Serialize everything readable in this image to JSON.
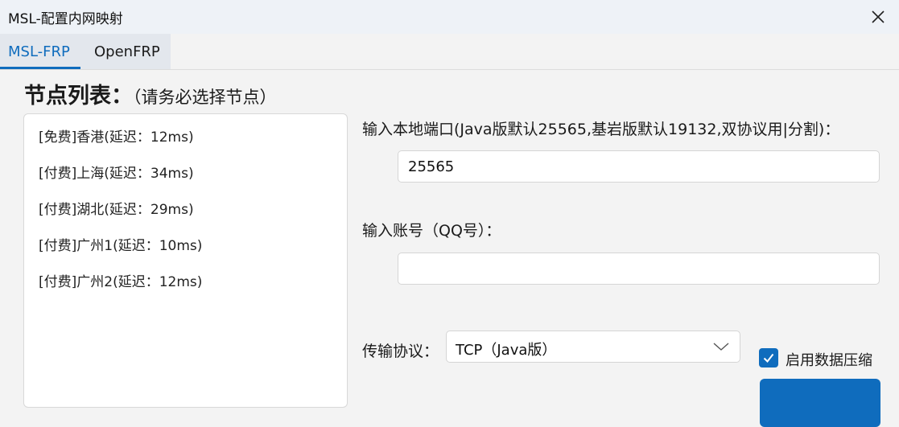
{
  "window": {
    "title": "MSL-配置内网映射"
  },
  "tabs": [
    {
      "label": "MSL-FRP",
      "active": true
    },
    {
      "label": "OpenFRP",
      "active": false
    }
  ],
  "node_section": {
    "title": "节点列表：",
    "hint": "（请务必选择节点）",
    "nodes": [
      "[免费]香港(延迟：12ms)",
      "[付费]上海(延迟：34ms)",
      "[付费]湖北(延迟：29ms)",
      "[付费]广州1(延迟：10ms)",
      "[付费]广州2(延迟：12ms)"
    ]
  },
  "port_field": {
    "label": "输入本地端口(Java版默认25565,基岩版默认19132,双协议用|分割)：",
    "value": "25565"
  },
  "account_field": {
    "label": "输入账号（QQ号）：",
    "value": ""
  },
  "protocol": {
    "label": "传输协议：",
    "selected": "TCP（Java版）"
  },
  "compression": {
    "label": "启用数据压缩",
    "checked": true
  },
  "colors": {
    "accent": "#0f6cbd",
    "titlebar": "#eef2f7",
    "background": "#f3f3f3"
  }
}
